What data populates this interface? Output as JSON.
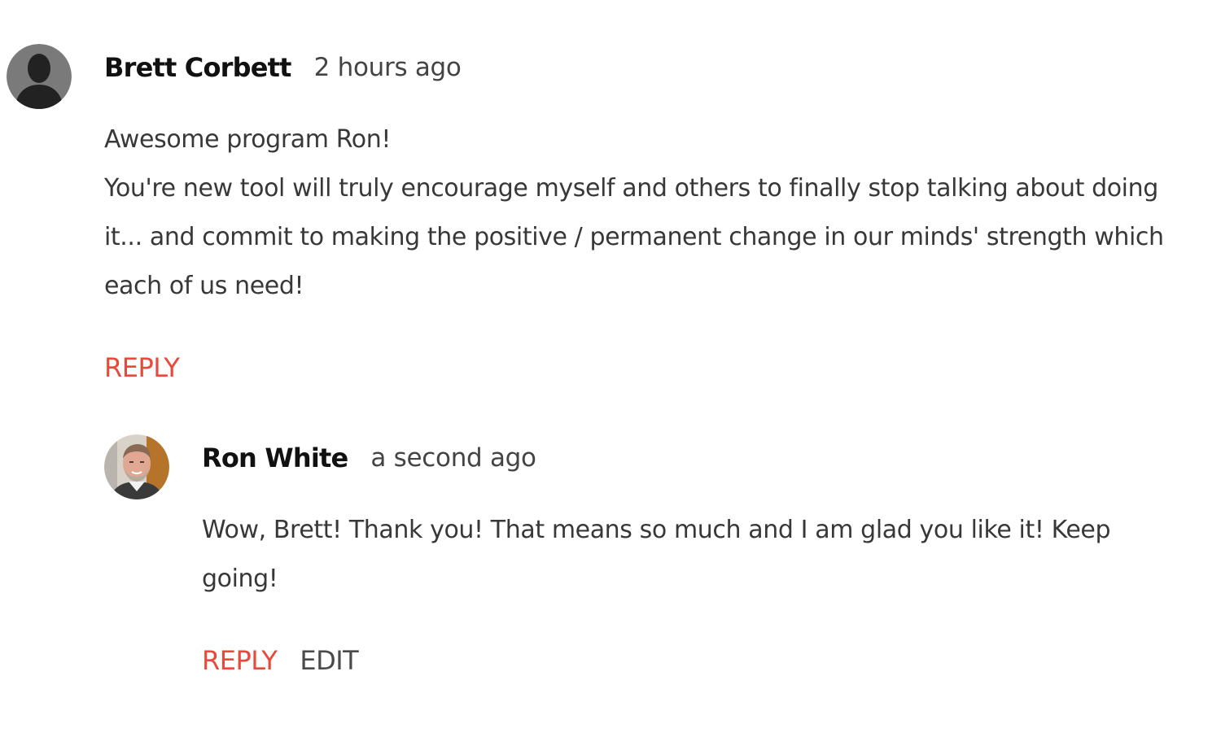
{
  "comments": [
    {
      "author": "Brett Corbett",
      "time": "2 hours ago",
      "avatar_icon": "default-user-silhouette",
      "text_lines": [
        "Awesome program Ron!",
        "You're new tool will truly encourage myself and others to finally stop talking about doing it... and commit to making the positive / permanent change in our minds' strength which each of us need!"
      ],
      "reply_label": "REPLY"
    }
  ],
  "replies": [
    {
      "author": "Ron White",
      "time": "a second ago",
      "avatar_icon": "user-photo",
      "text_lines": [
        "Wow, Brett! Thank you! That means so much and I am glad you like it! Keep going!"
      ],
      "reply_label": "REPLY",
      "edit_label": "EDIT"
    }
  ],
  "colors": {
    "reply_accent": "#e64a3b",
    "author": "#111111",
    "body_text": "#383838"
  }
}
